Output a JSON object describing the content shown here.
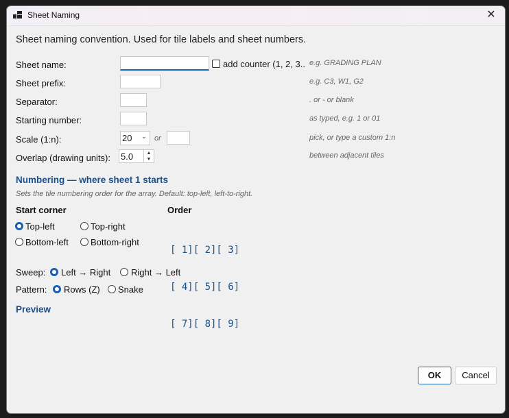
{
  "window": {
    "title": "Sheet Naming",
    "close_glyph": "✕"
  },
  "description": "Sheet naming convention. Used for tile labels and sheet numbers.",
  "fields": {
    "sheet_name": {
      "label": "Sheet name:",
      "value": "",
      "hint": "e.g. GRADING PLAN"
    },
    "add_counter": {
      "label": "add counter (1, 2, 3...)",
      "checked": false
    },
    "sheet_prefix": {
      "label": "Sheet prefix:",
      "value": "",
      "hint": "e.g. C3, W1, G2"
    },
    "separator": {
      "label": "Separator:",
      "value": "",
      "hint": ". or - or blank"
    },
    "starting_number": {
      "label": "Starting number:",
      "value": "",
      "hint": "as typed, e.g. 1 or 01"
    },
    "scale": {
      "label": "Scale (1:n):",
      "selected": "20",
      "or": "or",
      "custom": "",
      "hint": "pick, or type a custom 1:n"
    },
    "overlap": {
      "label": "Overlap (drawing units):",
      "value": "5.0",
      "hint": "between adjacent tiles"
    }
  },
  "numbering": {
    "heading": "Numbering — where sheet 1 starts",
    "subtitle": "Sets the tile numbering order for the array. Default: top-left, left-to-right.",
    "start_corner": {
      "heading": "Start corner",
      "options": [
        "Top-left",
        "Top-right",
        "Bottom-left",
        "Bottom-right"
      ],
      "selected": "Top-left"
    },
    "order": {
      "heading": "Order",
      "rows": [
        "[ 1][ 2][ 3]",
        "[ 4][ 5][ 6]",
        "[ 7][ 8][ 9]"
      ]
    },
    "sweep": {
      "label": "Sweep:",
      "options": [
        "Left → Right",
        "Right → Left"
      ],
      "selected": "Left → Right"
    },
    "pattern": {
      "label": "Pattern:",
      "options": [
        "Rows (Z)",
        "Snake"
      ],
      "selected": "Rows (Z)"
    }
  },
  "preview": {
    "heading": "Preview"
  },
  "buttons": {
    "ok": "OK",
    "cancel": "Cancel"
  },
  "colors": {
    "accent": "#1a5fb4",
    "heading": "#1b4f8a"
  }
}
